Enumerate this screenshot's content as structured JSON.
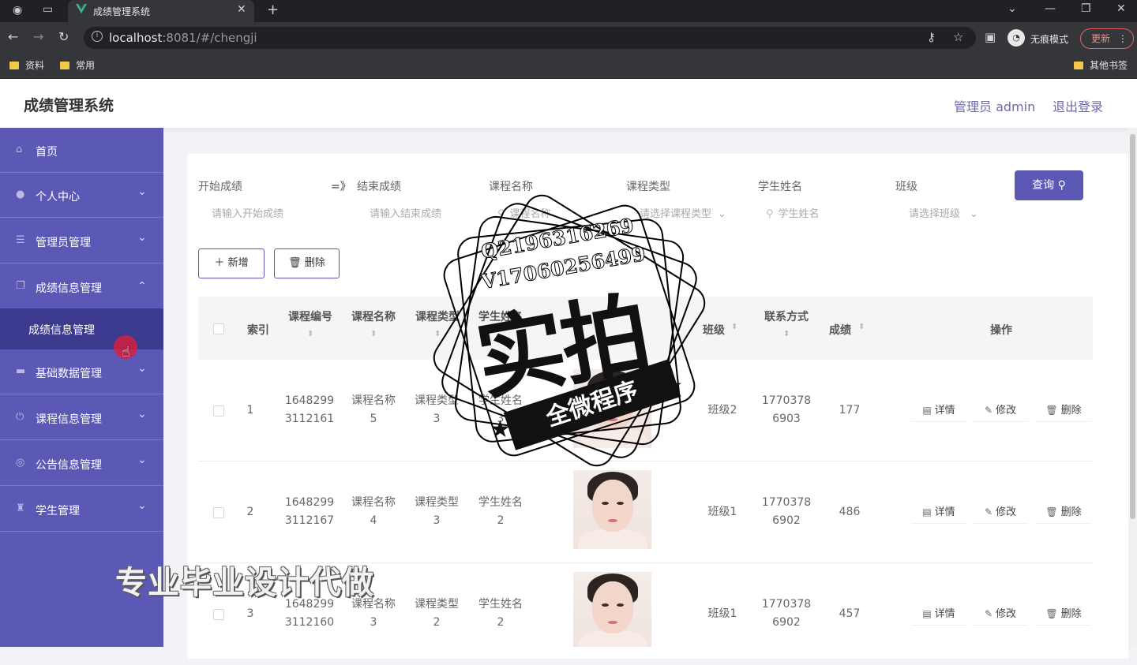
{
  "browser": {
    "tab_title": "成绩管理系统",
    "url_host": "localhost",
    "url_rest": ":8081/#/chengji",
    "incognito_label": "无痕模式",
    "update_label": "更新",
    "bookmarks": [
      "资料",
      "常用"
    ],
    "other_bookmarks": "其他书签"
  },
  "header": {
    "title": "成绩管理系统",
    "user": "管理员 admin",
    "logout": "退出登录"
  },
  "sidebar": {
    "items": [
      {
        "label": "首页",
        "icon": "home-icon"
      },
      {
        "label": "个人中心",
        "icon": "user-icon"
      },
      {
        "label": "管理员管理",
        "icon": "list-icon"
      },
      {
        "label": "成绩信息管理",
        "icon": "copy-icon",
        "expanded": true
      },
      {
        "label": "基础数据管理",
        "icon": "monitor-icon"
      },
      {
        "label": "课程信息管理",
        "icon": "power-icon"
      },
      {
        "label": "公告信息管理",
        "icon": "compass-icon"
      },
      {
        "label": "学生管理",
        "icon": "trophy-icon"
      }
    ],
    "submenu_label": "成绩信息管理"
  },
  "filters": {
    "labels": {
      "start_score": "开始成绩",
      "end_score": "结束成绩",
      "course_name": "课程名称",
      "course_type": "课程类型",
      "student_name": "学生姓名",
      "class": "班级"
    },
    "range_sep": "=》",
    "placeholders": {
      "start_score": "请输入开始成绩",
      "end_score": "请输入结束成绩",
      "course_name": "课程名称",
      "course_type": "请选择课程类型",
      "student_name": "学生姓名",
      "class": "请选择班级"
    },
    "query_button": "查询"
  },
  "actions": {
    "add": "新增",
    "delete": "删除"
  },
  "table": {
    "headers": {
      "index": "索引",
      "course_no": "课程编号",
      "course_name": "课程名称",
      "course_type": "课程类型",
      "student_name": "学生姓名",
      "class": "班级",
      "contact": "联系方式",
      "score": "成绩",
      "ops": "操作"
    },
    "rows": [
      {
        "index": "1",
        "course_no_1": "1648299",
        "course_no_2": "3112161",
        "course_name_1": "课程名称",
        "course_name_2": "5",
        "course_type_1": "课程类型",
        "course_type_2": "3",
        "student_1": "学生姓名",
        "student_2": "3",
        "class": "班级2",
        "contact_1": "1770378",
        "contact_2": "6903",
        "score": "177"
      },
      {
        "index": "2",
        "course_no_1": "1648299",
        "course_no_2": "3112167",
        "course_name_1": "课程名称",
        "course_name_2": "4",
        "course_type_1": "课程类型",
        "course_type_2": "3",
        "student_1": "学生姓名",
        "student_2": "2",
        "class": "班级1",
        "contact_1": "1770378",
        "contact_2": "6902",
        "score": "486"
      },
      {
        "index": "3",
        "course_no_1": "1648299",
        "course_no_2": "3112160",
        "course_name_1": "课程名称",
        "course_name_2": "3",
        "course_type_1": "课程类型",
        "course_type_2": "2",
        "student_1": "学生姓名",
        "student_2": "2",
        "class": "班级1",
        "contact_1": "1770378",
        "contact_2": "6902",
        "score": "457"
      }
    ],
    "row_actions": {
      "detail": "详情",
      "edit": "修改",
      "delete": "删除"
    }
  },
  "watermark": {
    "qq": "Q2196316269",
    "vx": "V17060256499",
    "big": "实拍",
    "ribbon": "全微程序",
    "bottom": "专业毕业设计代做"
  },
  "colors": {
    "sidebar": "#5b59b5",
    "submenu": "#3c3a8e",
    "accent": "#5b59b5"
  }
}
